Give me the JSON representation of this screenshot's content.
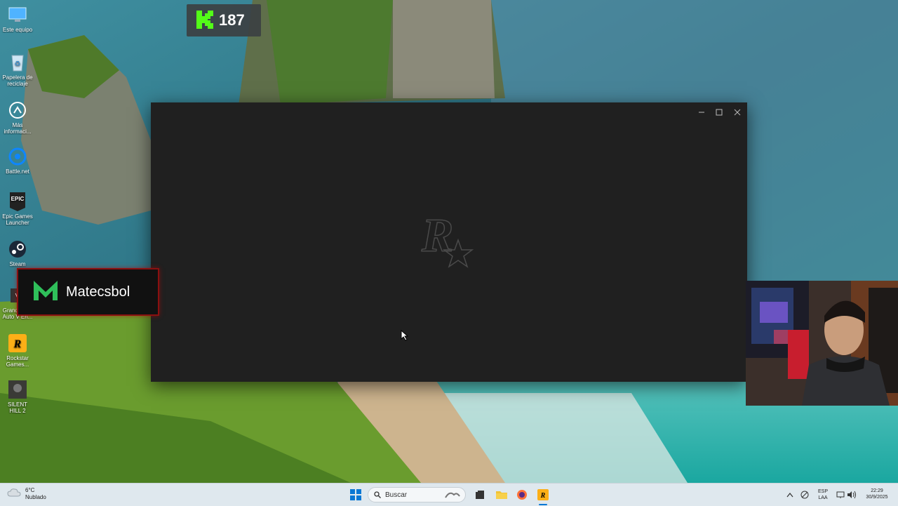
{
  "desktop": {
    "icons": [
      {
        "label": "Este equipo",
        "icon": "monitor-icon"
      },
      {
        "label": "Papelera de reciclaje",
        "icon": "recycle-bin-icon"
      },
      {
        "label": "Más informaci...",
        "icon": "info-circle-icon"
      },
      {
        "label": "Battle.net",
        "icon": "battlenet-icon"
      },
      {
        "label": "Epic Games Launcher",
        "icon": "epic-games-icon"
      },
      {
        "label": "Steam",
        "icon": "steam-icon"
      },
      {
        "label": "Grand Theft Auto V En...",
        "icon": "gta-icon"
      },
      {
        "label": "Rockstar Games...",
        "icon": "rockstar-icon"
      },
      {
        "label": "SILENT HILL 2",
        "icon": "silent-hill-icon"
      }
    ]
  },
  "overlay": {
    "kick_count": "187",
    "channel_name": "Matecsbol"
  },
  "window": {
    "logo_text": "R",
    "controls": [
      "minimize-icon",
      "maximize-icon",
      "close-icon"
    ]
  },
  "taskbar": {
    "weather_temp": "6°C",
    "weather_desc": "Nublado",
    "search_placeholder": "Buscar",
    "lang_top": "ESP",
    "lang_bottom": "LAA",
    "time": "22:29",
    "date": "30/9/2025"
  },
  "colors": {
    "window_bg": "#202020",
    "kick_green": "#53fc18",
    "banner_border": "#8a1010",
    "taskbar_bg": "#dfe8ee"
  }
}
